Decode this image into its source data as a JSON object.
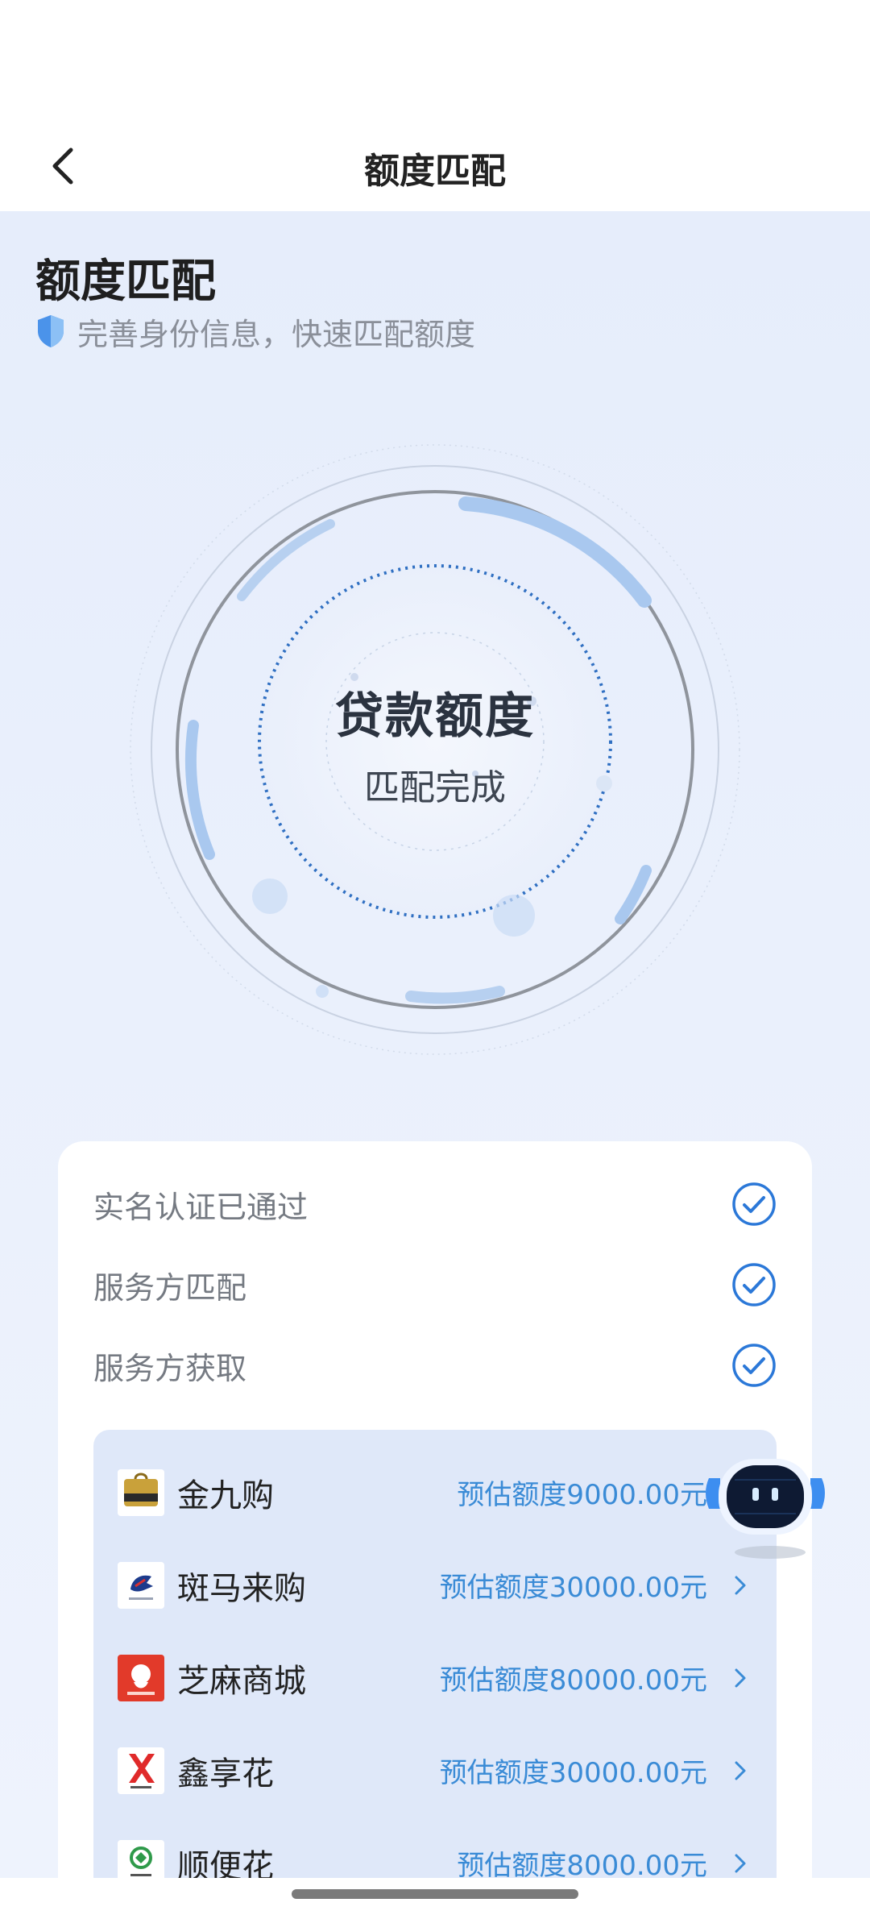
{
  "header": {
    "title": "额度匹配"
  },
  "hero": {
    "heading": "额度匹配",
    "subtitle": "完善身份信息，快速匹配额度"
  },
  "circle": {
    "title": "贷款额度",
    "status": "匹配完成"
  },
  "checklist": [
    {
      "label": "实名认证已通过"
    },
    {
      "label": "服务方匹配"
    },
    {
      "label": "服务方获取"
    }
  ],
  "providers": [
    {
      "name": "金九购",
      "amount": "预估额度9000.00元",
      "logo_text": "金九购"
    },
    {
      "name": "斑马来购",
      "amount": "预估额度30000.00元",
      "logo_text": ""
    },
    {
      "name": "芝麻商城",
      "amount": "预估额度80000.00元",
      "logo_text": ""
    },
    {
      "name": "鑫享花",
      "amount": "预估额度30000.00元",
      "logo_text": ""
    },
    {
      "name": "顺便花",
      "amount": "预估额度8000.00元",
      "logo_text": ""
    }
  ],
  "colors": {
    "accent": "#2b78d8",
    "amount": "#3a8bd6",
    "panel": "#dfe8f9"
  }
}
